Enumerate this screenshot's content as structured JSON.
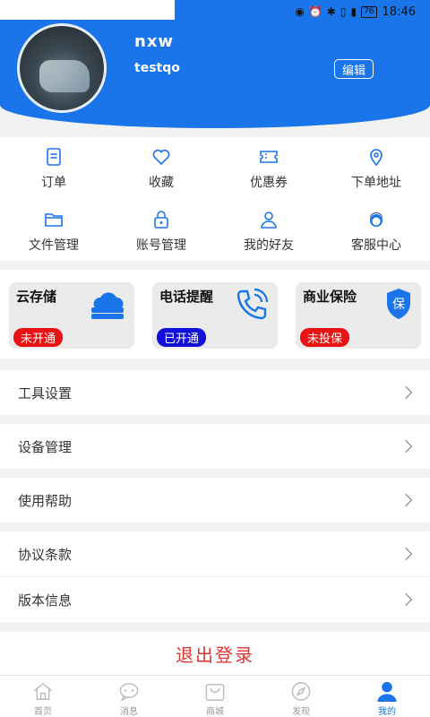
{
  "status_bar": {
    "time": "18:46",
    "battery": "76"
  },
  "profile": {
    "name": "nxw",
    "account": "testqo",
    "edit_label": "编辑"
  },
  "quick_grid": [
    {
      "label": "订单",
      "icon": "order-icon"
    },
    {
      "label": "收藏",
      "icon": "heart-icon"
    },
    {
      "label": "优惠券",
      "icon": "coupon-icon"
    },
    {
      "label": "下单地址",
      "icon": "location-pin-icon"
    },
    {
      "label": "文件管理",
      "icon": "folder-icon"
    },
    {
      "label": "账号管理",
      "icon": "lock-icon"
    },
    {
      "label": "我的好友",
      "icon": "person-icon"
    },
    {
      "label": "客服中心",
      "icon": "customer-service-icon"
    }
  ],
  "service_cards": [
    {
      "title": "云存储",
      "badge": "未开通",
      "badge_color": "#e81414",
      "icon": "cloud-storage-icon"
    },
    {
      "title": "电话提醒",
      "badge": "已开通",
      "badge_color": "#1010d8",
      "icon": "phone-icon"
    },
    {
      "title": "商业保险",
      "badge": "未投保",
      "badge_color": "#e81414",
      "icon": "shield-icon",
      "icon_text": "保"
    }
  ],
  "menu": [
    {
      "label": "工具设置"
    },
    {
      "label": "设备管理"
    },
    {
      "label": "使用帮助"
    },
    {
      "label": "协议条款"
    },
    {
      "label": "版本信息"
    }
  ],
  "logout_label": "退出登录",
  "tabbar": [
    {
      "label": "首页",
      "icon": "home-icon",
      "active": false
    },
    {
      "label": "消息",
      "icon": "message-icon",
      "active": false
    },
    {
      "label": "商城",
      "icon": "shop-bag-icon",
      "active": false
    },
    {
      "label": "发现",
      "icon": "compass-icon",
      "active": false
    },
    {
      "label": "我的",
      "icon": "user-icon",
      "active": true
    }
  ],
  "colors": {
    "primary": "#1a75ea",
    "danger": "#e0322f",
    "icon_blue": "#1a75ea",
    "tab_inactive": "#999999"
  }
}
